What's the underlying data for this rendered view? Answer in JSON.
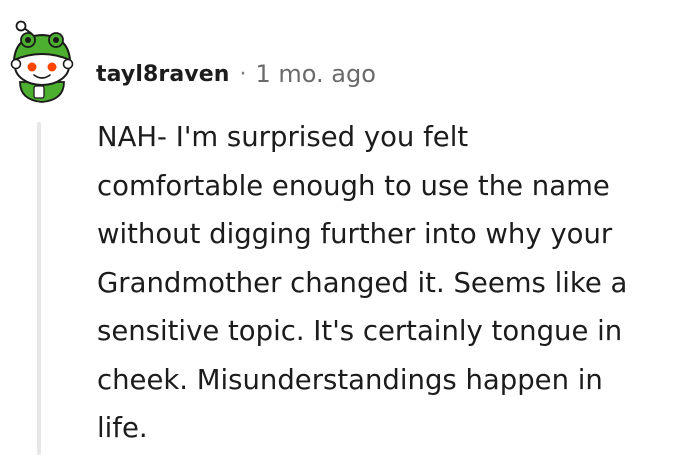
{
  "comment": {
    "author": "tayl8raven",
    "separator": "·",
    "timestamp": "1 mo. ago",
    "avatar_icon": "snoo-frog-hat-avatar-icon",
    "body_lines": [
      "NAH- I'm surprised you felt",
      "comfortable enough to use the name",
      "without digging further into why your",
      "Grandmother changed it. Seems like a",
      "sensitive topic. It's certainly tongue in",
      "cheek. Misunderstandings happen in",
      "life."
    ]
  },
  "colors": {
    "author": "#1c1c1c",
    "timestamp": "#6a6a6a",
    "thread_line": "#e7e7e7",
    "avatar_green": "#4caf2f",
    "avatar_eye_red": "#ff4500"
  }
}
